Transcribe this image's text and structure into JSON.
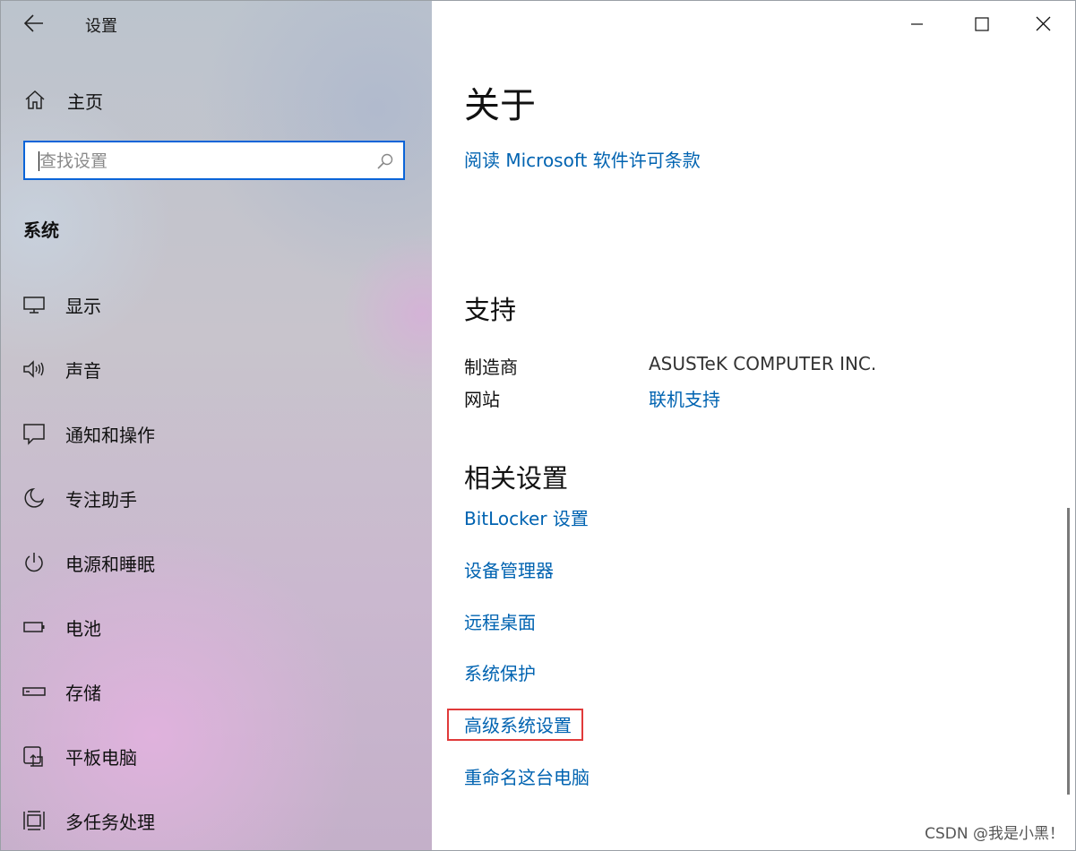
{
  "window": {
    "title": "设置"
  },
  "sidebar": {
    "home_label": "主页",
    "search": {
      "placeholder": "查找设置",
      "value": ""
    },
    "section_title": "系统",
    "items": [
      {
        "label": "显示",
        "icon": "monitor-icon"
      },
      {
        "label": "声音",
        "icon": "speaker-icon"
      },
      {
        "label": "通知和操作",
        "icon": "notification-icon"
      },
      {
        "label": "专注助手",
        "icon": "moon-icon"
      },
      {
        "label": "电源和睡眠",
        "icon": "power-icon"
      },
      {
        "label": "电池",
        "icon": "battery-icon"
      },
      {
        "label": "存储",
        "icon": "storage-icon"
      },
      {
        "label": "平板电脑",
        "icon": "tablet-icon"
      },
      {
        "label": "多任务处理",
        "icon": "multitask-icon"
      }
    ]
  },
  "main": {
    "heading": "关于",
    "license_link": "阅读 Microsoft 软件许可条款",
    "support": {
      "heading": "支持",
      "manufacturer_label": "制造商",
      "manufacturer_value": "ASUSTeK COMPUTER INC.",
      "website_label": "网站",
      "website_link": "联机支持"
    },
    "related": {
      "heading": "相关设置",
      "links": [
        "BitLocker 设置",
        "设备管理器",
        "远程桌面",
        "系统保护",
        "高级系统设置",
        "重命名这台电脑"
      ]
    }
  },
  "watermark": "CSDN @我是小黑！",
  "colors": {
    "accent": "#0063b1",
    "search_border": "#0a64d8",
    "highlight": "#e03a3a"
  }
}
